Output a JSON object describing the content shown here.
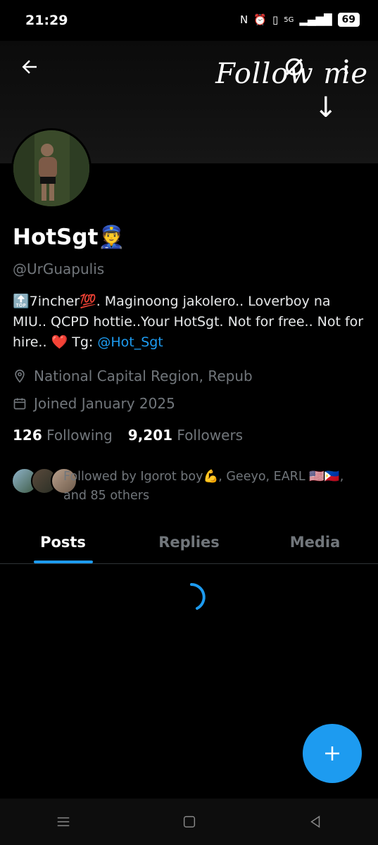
{
  "status_bar": {
    "time": "21:29",
    "network": "5G",
    "battery": "69"
  },
  "banner": {
    "text": "Follow me",
    "arrow": "↓"
  },
  "header": {
    "back_icon": "arrow-left-icon",
    "grok_icon": "slashed-circle-icon",
    "more_icon": "more-vertical-icon"
  },
  "profile": {
    "name": "HotSgt",
    "name_emoji": "👮",
    "handle": "@UrGuapulis",
    "bio_text": "🔝7incher💯. Maginoong jakolero.. Loverboy na MIU.. QCPD hottie..Your HotSgt. Not for free.. Not for hire.. ❤️ Tg: ",
    "bio_link": "@Hot_Sgt",
    "location": "National Capital Region, Repub",
    "joined": "Joined January 2025",
    "following_count": "126",
    "following_label": "Following",
    "followers_count": "9,201",
    "followers_label": "Followers",
    "followed_by": "Followed by Igorot boy💪, Geeyo, EARL 🇺🇸🇵🇭, and 85 others"
  },
  "tabs": [
    {
      "label": "Posts"
    },
    {
      "label": "Replies"
    },
    {
      "label": "Media"
    }
  ],
  "colors": {
    "accent": "#1d9bf0",
    "secondary_text": "#71767b"
  }
}
